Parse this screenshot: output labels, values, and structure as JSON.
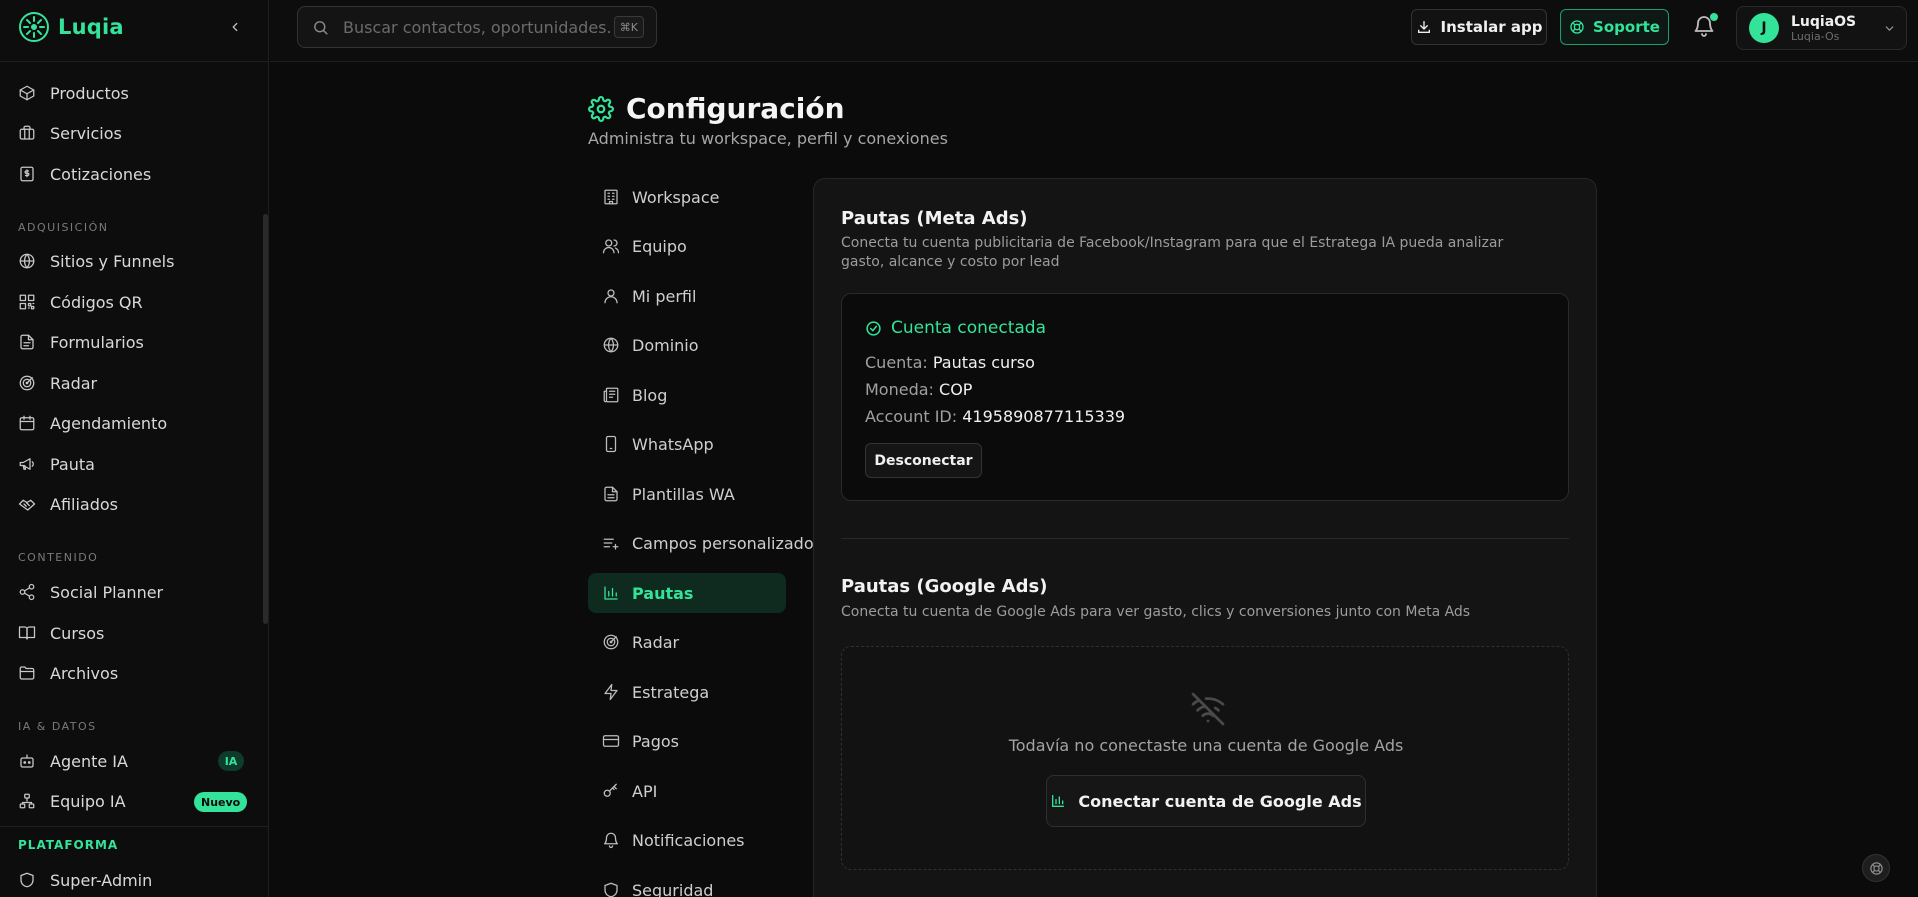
{
  "brand": {
    "name": "Luqia",
    "accent": "#34e39a"
  },
  "sidebar": {
    "groups": [
      {
        "items": [
          {
            "label": "Productos",
            "icon": "box-icon"
          },
          {
            "label": "Servicios",
            "icon": "briefcase-icon"
          },
          {
            "label": "Cotizaciones",
            "icon": "receipt-icon"
          }
        ]
      },
      {
        "heading": "ADQUISICIÓN",
        "items": [
          {
            "label": "Sitios y Funnels",
            "icon": "globe-icon"
          },
          {
            "label": "Códigos QR",
            "icon": "qr-code-icon"
          },
          {
            "label": "Formularios",
            "icon": "form-icon"
          },
          {
            "label": "Radar",
            "icon": "radar-icon"
          },
          {
            "label": "Agendamiento",
            "icon": "calendar-icon"
          },
          {
            "label": "Pauta",
            "icon": "megaphone-icon"
          },
          {
            "label": "Afiliados",
            "icon": "handshake-icon"
          }
        ]
      },
      {
        "heading": "CONTENIDO",
        "items": [
          {
            "label": "Social Planner",
            "icon": "share-icon"
          },
          {
            "label": "Cursos",
            "icon": "book-icon"
          },
          {
            "label": "Archivos",
            "icon": "folder-icon"
          }
        ]
      },
      {
        "heading": "IA & DATOS",
        "items": [
          {
            "label": "Agente IA",
            "icon": "bot-icon",
            "badge": "IA"
          },
          {
            "label": "Equipo IA",
            "icon": "network-icon",
            "badge": "Nuevo"
          }
        ]
      }
    ],
    "platform": {
      "heading": "PLATAFORMA",
      "items": [
        {
          "label": "Super-Admin",
          "icon": "shield-icon"
        }
      ]
    }
  },
  "topbar": {
    "search_placeholder": "Buscar contactos, oportunidades...",
    "shortcut": "⌘K",
    "install_label": "Instalar app",
    "support_label": "Soporte",
    "user": {
      "initial": "J",
      "name": "LuqiaOS",
      "workspace": "Luqia-Os"
    }
  },
  "page": {
    "title": "Configuración",
    "subtitle": "Administra tu workspace, perfil y conexiones"
  },
  "settings_nav": [
    {
      "label": "Workspace",
      "icon": "building-icon"
    },
    {
      "label": "Equipo",
      "icon": "users-icon"
    },
    {
      "label": "Mi perfil",
      "icon": "user-icon"
    },
    {
      "label": "Dominio",
      "icon": "globe-icon"
    },
    {
      "label": "Blog",
      "icon": "newspaper-icon"
    },
    {
      "label": "WhatsApp",
      "icon": "phone-icon"
    },
    {
      "label": "Plantillas WA",
      "icon": "file-text-icon"
    },
    {
      "label": "Campos personalizados",
      "icon": "list-plus-icon"
    },
    {
      "label": "Pautas",
      "icon": "bar-chart-icon",
      "active": true
    },
    {
      "label": "Radar",
      "icon": "radar-icon"
    },
    {
      "label": "Estratega",
      "icon": "zap-icon"
    },
    {
      "label": "Pagos",
      "icon": "credit-card-icon"
    },
    {
      "label": "API",
      "icon": "key-icon"
    },
    {
      "label": "Notificaciones",
      "icon": "bell-icon"
    },
    {
      "label": "Seguridad",
      "icon": "shield-icon"
    }
  ],
  "meta_ads": {
    "title": "Pautas (Meta Ads)",
    "description": "Conecta tu cuenta publicitaria de Facebook/Instagram para que el Estratega IA pueda analizar gasto, alcance y costo por lead",
    "status": "Cuenta conectada",
    "fields": [
      {
        "key": "Cuenta:",
        "value": "Pautas curso"
      },
      {
        "key": "Moneda:",
        "value": "COP"
      },
      {
        "key": "Account ID:",
        "value": "4195890877115339"
      }
    ],
    "disconnect_label": "Desconectar"
  },
  "google_ads": {
    "title": "Pautas (Google Ads)",
    "description": "Conecta tu cuenta de Google Ads para ver gasto, clics y conversiones junto con Meta Ads",
    "empty_text": "Todavía no conectaste una cuenta de Google Ads",
    "connect_label": "Conectar cuenta de Google Ads"
  }
}
